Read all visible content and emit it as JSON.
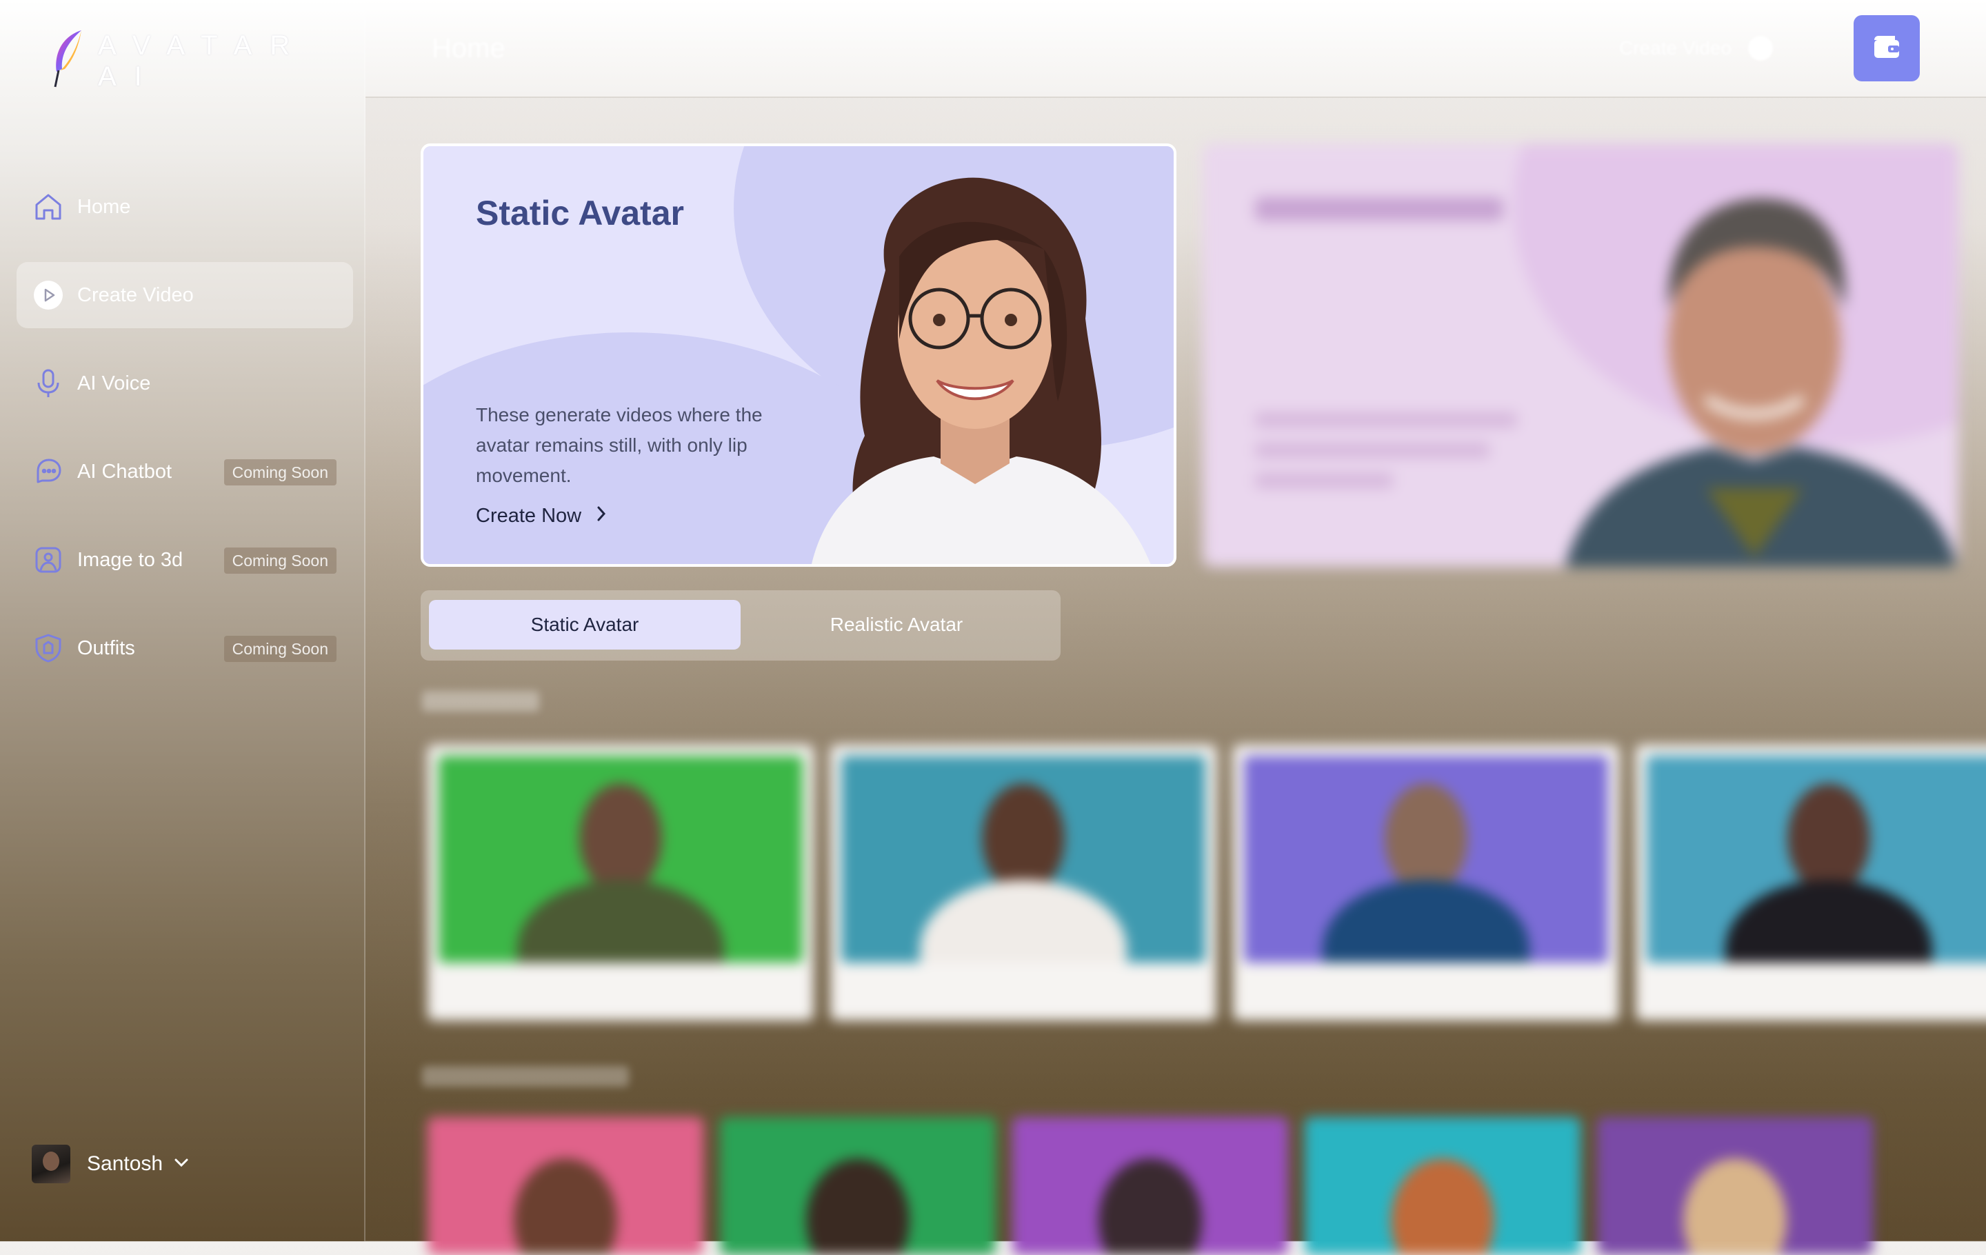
{
  "app": {
    "logo_text": "AVATAR AI"
  },
  "sidebar": {
    "items": [
      {
        "label": "Home",
        "icon": "home-icon"
      },
      {
        "label": "Create Video",
        "icon": "play-circle-icon",
        "active": true
      },
      {
        "label": "AI Voice",
        "icon": "microphone-icon"
      },
      {
        "label": "AI Chatbot",
        "icon": "chat-bubble-icon",
        "badge": "Coming Soon"
      },
      {
        "label": "Image to 3d",
        "icon": "image-3d-icon",
        "badge": "Coming Soon"
      },
      {
        "label": "Outfits",
        "icon": "shirt-shield-icon",
        "badge": "Coming Soon"
      }
    ],
    "user": {
      "name": "Santosh"
    }
  },
  "header": {
    "title": "Home",
    "create_video": "Create Video"
  },
  "hero": {
    "static": {
      "title": "Static Avatar",
      "description": "These generate videos where the avatar remains still, with only lip movement.",
      "cta": "Create Now"
    }
  },
  "toggle": {
    "static_label": "Static Avatar",
    "realistic_label": "Realistic Avatar",
    "selected": "Static Avatar"
  },
  "colors": {
    "accent": "#7f87f0",
    "hero_bg": "#e4e3fc",
    "hero_title": "#3e4a86"
  }
}
